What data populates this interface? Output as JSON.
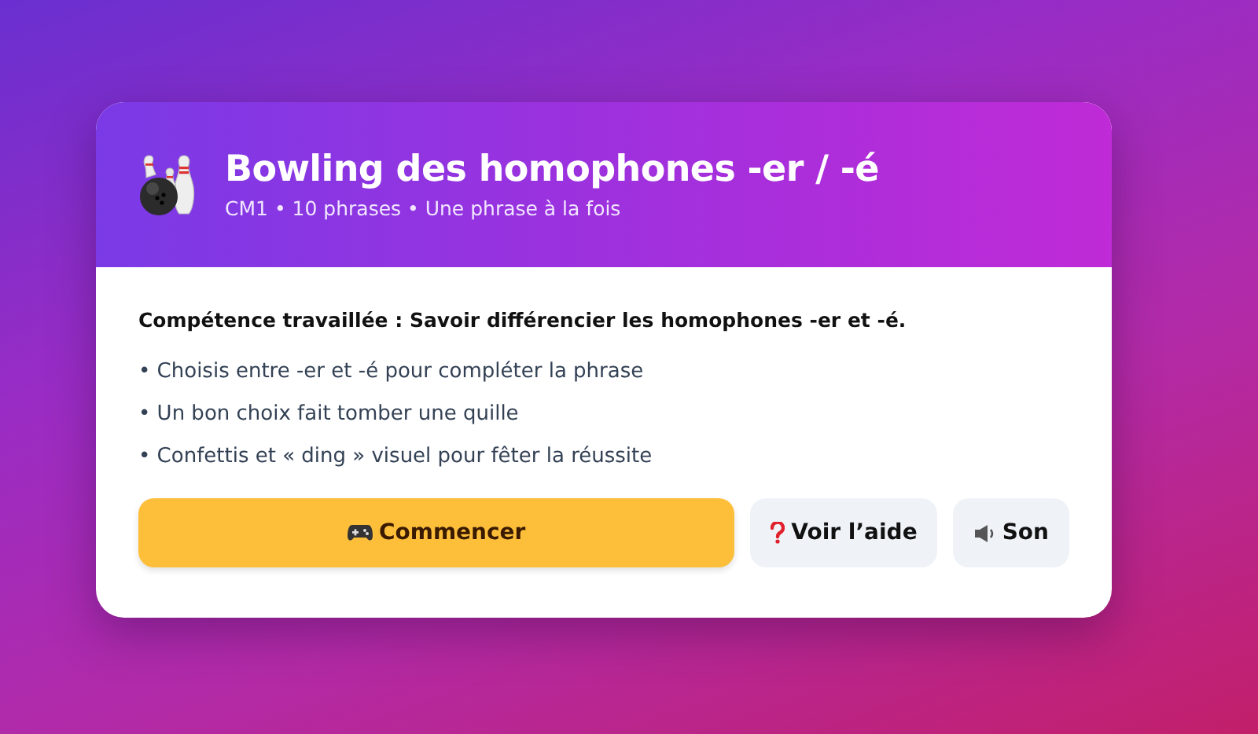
{
  "dialog": {
    "title": "Bowling des homophones -er / -é",
    "subtitle": "CM1 • 10 phrases • Une phrase à la fois",
    "skill": "Compétence travaillée : Savoir différencier les homophones -er et -é.",
    "bullets": [
      "• Choisis entre -er et -é pour compléter la phrase",
      "• Un bon choix fait tomber une quille",
      "• Confettis et « ding » visuel pour fêter la réussite"
    ],
    "buttons": [
      {
        "kind": "start",
        "label": "Commencer"
      },
      {
        "kind": "help",
        "label": "Voir l’aide"
      },
      {
        "kind": "sound",
        "label": "Son"
      }
    ]
  }
}
